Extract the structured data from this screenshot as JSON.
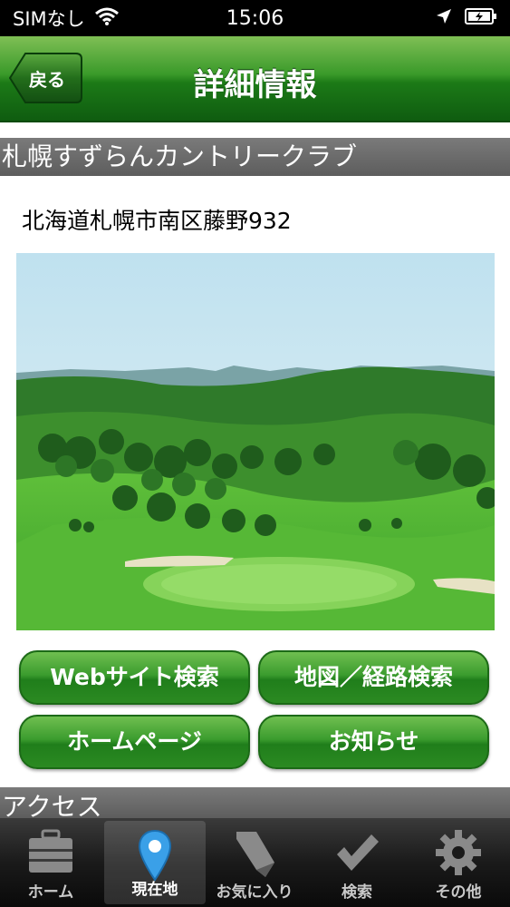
{
  "status_bar": {
    "carrier": "SIMなし",
    "time": "15:06",
    "icons": [
      "wifi-icon",
      "location-arrow-icon",
      "battery-charging-icon"
    ]
  },
  "nav": {
    "back_label": "戻る",
    "title": "詳細情報"
  },
  "club": {
    "name": "札幌すずらんカントリークラブ",
    "address": "北海道札幌市南区藤野932"
  },
  "buttons": {
    "web_search": "Webサイト検索",
    "map_route": "地図／経路検索",
    "homepage": "ホームページ",
    "news": "お知らせ"
  },
  "access_header": "アクセス",
  "tabs": [
    {
      "label": "ホーム",
      "icon": "briefcase-icon",
      "active": false
    },
    {
      "label": "現在地",
      "icon": "map-pin-icon",
      "active": true
    },
    {
      "label": "お気に入り",
      "icon": "bookmark-icon",
      "active": false
    },
    {
      "label": "検索",
      "icon": "checkmark-icon",
      "active": false
    },
    {
      "label": "その他",
      "icon": "gear-icon",
      "active": false
    }
  ],
  "colors": {
    "nav_green": "#1c7a17",
    "button_green": "#3b9c2e",
    "section_gray": "#5d5d5d",
    "pin_blue": "#3aa0e8"
  }
}
